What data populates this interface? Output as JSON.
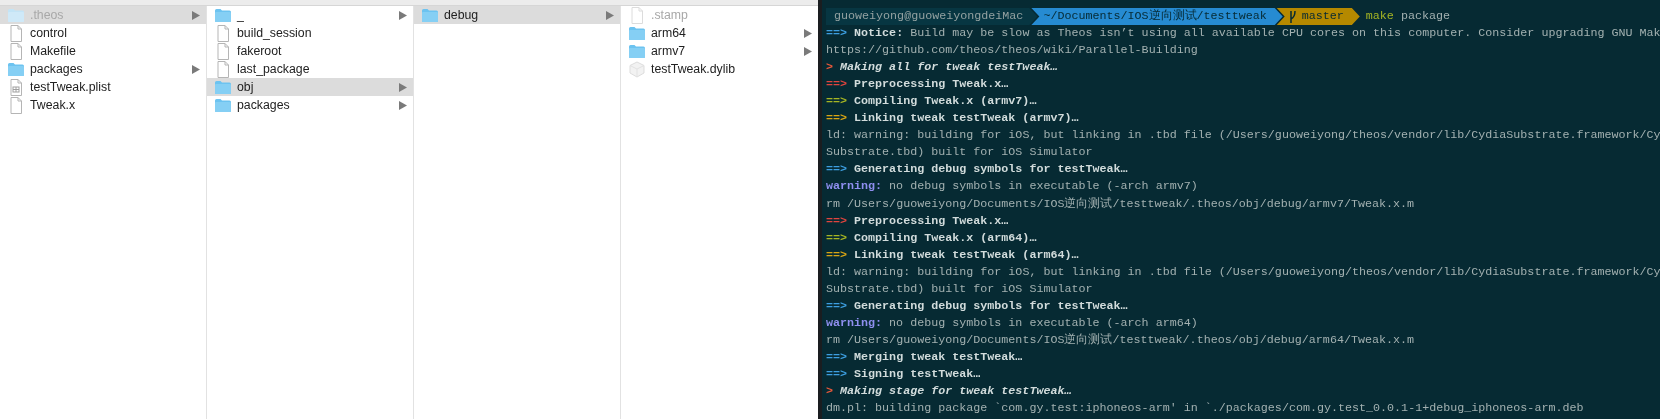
{
  "finder": {
    "columns": [
      {
        "items": [
          {
            "name": ".theos",
            "kind": "folder",
            "selected": true,
            "dimmed": true,
            "has_children": true
          },
          {
            "name": "control",
            "kind": "file",
            "selected": false,
            "dimmed": false,
            "has_children": false
          },
          {
            "name": "Makefile",
            "kind": "file",
            "selected": false,
            "dimmed": false,
            "has_children": false
          },
          {
            "name": "packages",
            "kind": "folder",
            "selected": false,
            "dimmed": false,
            "has_children": true
          },
          {
            "name": "testTweak.plist",
            "kind": "plist",
            "selected": false,
            "dimmed": false,
            "has_children": false
          },
          {
            "name": "Tweak.x",
            "kind": "file",
            "selected": false,
            "dimmed": false,
            "has_children": false
          }
        ]
      },
      {
        "items": [
          {
            "name": "_",
            "kind": "folder",
            "selected": false,
            "dimmed": false,
            "has_children": true
          },
          {
            "name": "build_session",
            "kind": "file",
            "selected": false,
            "dimmed": false,
            "has_children": false
          },
          {
            "name": "fakeroot",
            "kind": "file",
            "selected": false,
            "dimmed": false,
            "has_children": false
          },
          {
            "name": "last_package",
            "kind": "file",
            "selected": false,
            "dimmed": false,
            "has_children": false
          },
          {
            "name": "obj",
            "kind": "folder",
            "selected": true,
            "dimmed": false,
            "has_children": true
          },
          {
            "name": "packages",
            "kind": "folder",
            "selected": false,
            "dimmed": false,
            "has_children": true
          }
        ]
      },
      {
        "items": [
          {
            "name": "debug",
            "kind": "folder",
            "selected": true,
            "dimmed": false,
            "has_children": true
          }
        ]
      },
      {
        "items": [
          {
            "name": ".stamp",
            "kind": "file",
            "selected": false,
            "dimmed": true,
            "has_children": false
          },
          {
            "name": "arm64",
            "kind": "folder",
            "selected": false,
            "dimmed": false,
            "has_children": true
          },
          {
            "name": "armv7",
            "kind": "folder",
            "selected": false,
            "dimmed": false,
            "has_children": true
          },
          {
            "name": "testTweak.dylib",
            "kind": "dylib",
            "selected": false,
            "dimmed": false,
            "has_children": false
          }
        ]
      }
    ]
  },
  "terminal": {
    "lines": [
      {
        "kind": "prompt",
        "user": "guoweiyong@guoweiyongdeiMac",
        "path": "~/Documents/IOS逆向测试/testtweak",
        "branch": "master",
        "command": "make",
        "argument": "package"
      },
      {
        "kind": "plain",
        "marker": "==>",
        "color": "#3d9ee0",
        "text": "**Notice:** Build may be slow as Theos isn’t using all available CPU cores on this computer. Consider upgrading GNU Mak"
      },
      {
        "kind": "plain",
        "text": "https://github.com/theos/theos/wiki/Parallel-Building"
      },
      {
        "kind": "heading",
        "marker": ">",
        "color": "#e8583a",
        "text": "Making all for tweak testTweak…"
      },
      {
        "kind": "step",
        "marker": "==>",
        "color": "#e0443e",
        "text": "Preprocessing Tweak.x…"
      },
      {
        "kind": "step",
        "marker": "==>",
        "color": "#a6b523",
        "text": "Compiling Tweak.x (armv7)…"
      },
      {
        "kind": "step",
        "marker": "==>",
        "color": "#d9a514",
        "text": "Linking tweak testTweak (armv7)…"
      },
      {
        "kind": "plain",
        "text": "ld: warning: building for iOS, but linking in .tbd file (/Users/guoweiyong/theos/vendor/lib/CydiaSubstrate.framework/Cy"
      },
      {
        "kind": "plain",
        "text": "Substrate.tbd) built for iOS Simulator"
      },
      {
        "kind": "step",
        "marker": "==>",
        "color": "#3d9ee0",
        "text": "Generating debug symbols for testTweak…"
      },
      {
        "kind": "plain",
        "marker": "warning:",
        "color": "#8f8ff0",
        "text": "no debug symbols in executable (-arch armv7)"
      },
      {
        "kind": "plain",
        "text": "rm /Users/guoweiyong/Documents/IOS逆向测试/testtweak/.theos/obj/debug/armv7/Tweak.x.m"
      },
      {
        "kind": "step",
        "marker": "==>",
        "color": "#e0443e",
        "text": "Preprocessing Tweak.x…"
      },
      {
        "kind": "step",
        "marker": "==>",
        "color": "#a6b523",
        "text": "Compiling Tweak.x (arm64)…"
      },
      {
        "kind": "step",
        "marker": "==>",
        "color": "#d9a514",
        "text": "Linking tweak testTweak (arm64)…"
      },
      {
        "kind": "plain",
        "text": "ld: warning: building for iOS, but linking in .tbd file (/Users/guoweiyong/theos/vendor/lib/CydiaSubstrate.framework/Cy"
      },
      {
        "kind": "plain",
        "text": "Substrate.tbd) built for iOS Simulator"
      },
      {
        "kind": "step",
        "marker": "==>",
        "color": "#3d9ee0",
        "text": "Generating debug symbols for testTweak…"
      },
      {
        "kind": "plain",
        "marker": "warning:",
        "color": "#8f8ff0",
        "text": "no debug symbols in executable (-arch arm64)"
      },
      {
        "kind": "plain",
        "text": "rm /Users/guoweiyong/Documents/IOS逆向测试/testtweak/.theos/obj/debug/arm64/Tweak.x.m"
      },
      {
        "kind": "step",
        "marker": "==>",
        "color": "#3d9ee0",
        "text": "Merging tweak testTweak…"
      },
      {
        "kind": "step",
        "marker": "==>",
        "color": "#3d9ee0",
        "text": "Signing testTweak…"
      },
      {
        "kind": "heading",
        "marker": ">",
        "color": "#e8583a",
        "text": "Making stage for tweak testTweak…"
      },
      {
        "kind": "plain",
        "text": "dm.pl: building package `com.gy.test:iphoneos-arm' in `./packages/com.gy.test_0.0.1-1+debug_iphoneos-arm.deb"
      }
    ]
  }
}
